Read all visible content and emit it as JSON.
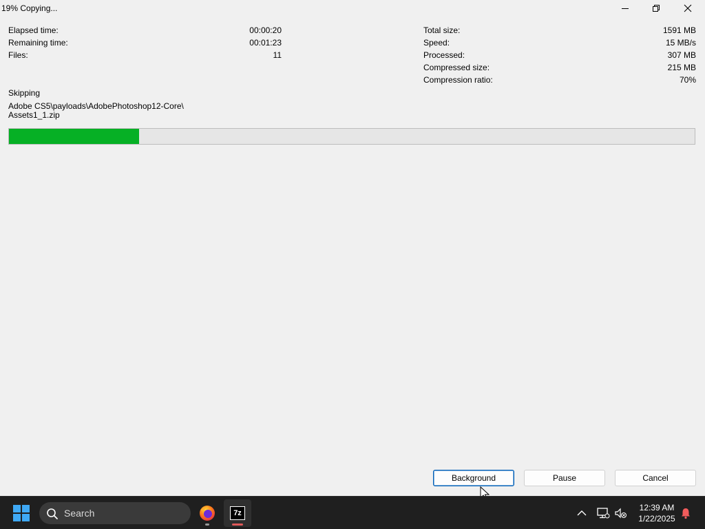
{
  "window": {
    "title": "19% Copying...",
    "controls": {
      "minimize_icon": "minimize-icon",
      "restore_icon": "restore-icon",
      "close_icon": "close-icon"
    }
  },
  "stats_left": [
    {
      "label": "Elapsed time:",
      "value": "00:00:20"
    },
    {
      "label": "Remaining time:",
      "value": "00:01:23"
    },
    {
      "label": "Files:",
      "value": "11"
    }
  ],
  "stats_right": [
    {
      "label": "Total size:",
      "value": "1591 MB"
    },
    {
      "label": "Speed:",
      "value": "15 MB/s"
    },
    {
      "label": "Processed:",
      "value": "307 MB"
    },
    {
      "label": "Compressed size:",
      "value": "215 MB"
    },
    {
      "label": "Compression ratio:",
      "value": "70%"
    }
  ],
  "status": {
    "label": "Skipping",
    "path_line1": "Adobe CS5\\payloads\\AdobePhotoshop12-Core\\",
    "path_line2": "Assets1_1.zip"
  },
  "progress": {
    "fraction": 0.19,
    "color": "#06b025"
  },
  "buttons": {
    "background": "Background",
    "pause": "Pause",
    "cancel": "Cancel"
  },
  "taskbar": {
    "search_placeholder": "Search",
    "apps": [
      "firefox-icon",
      "7zip-icon"
    ],
    "seven_zip_label": "7z",
    "clock_time": "12:39 AM",
    "clock_date": "1/22/2025"
  }
}
